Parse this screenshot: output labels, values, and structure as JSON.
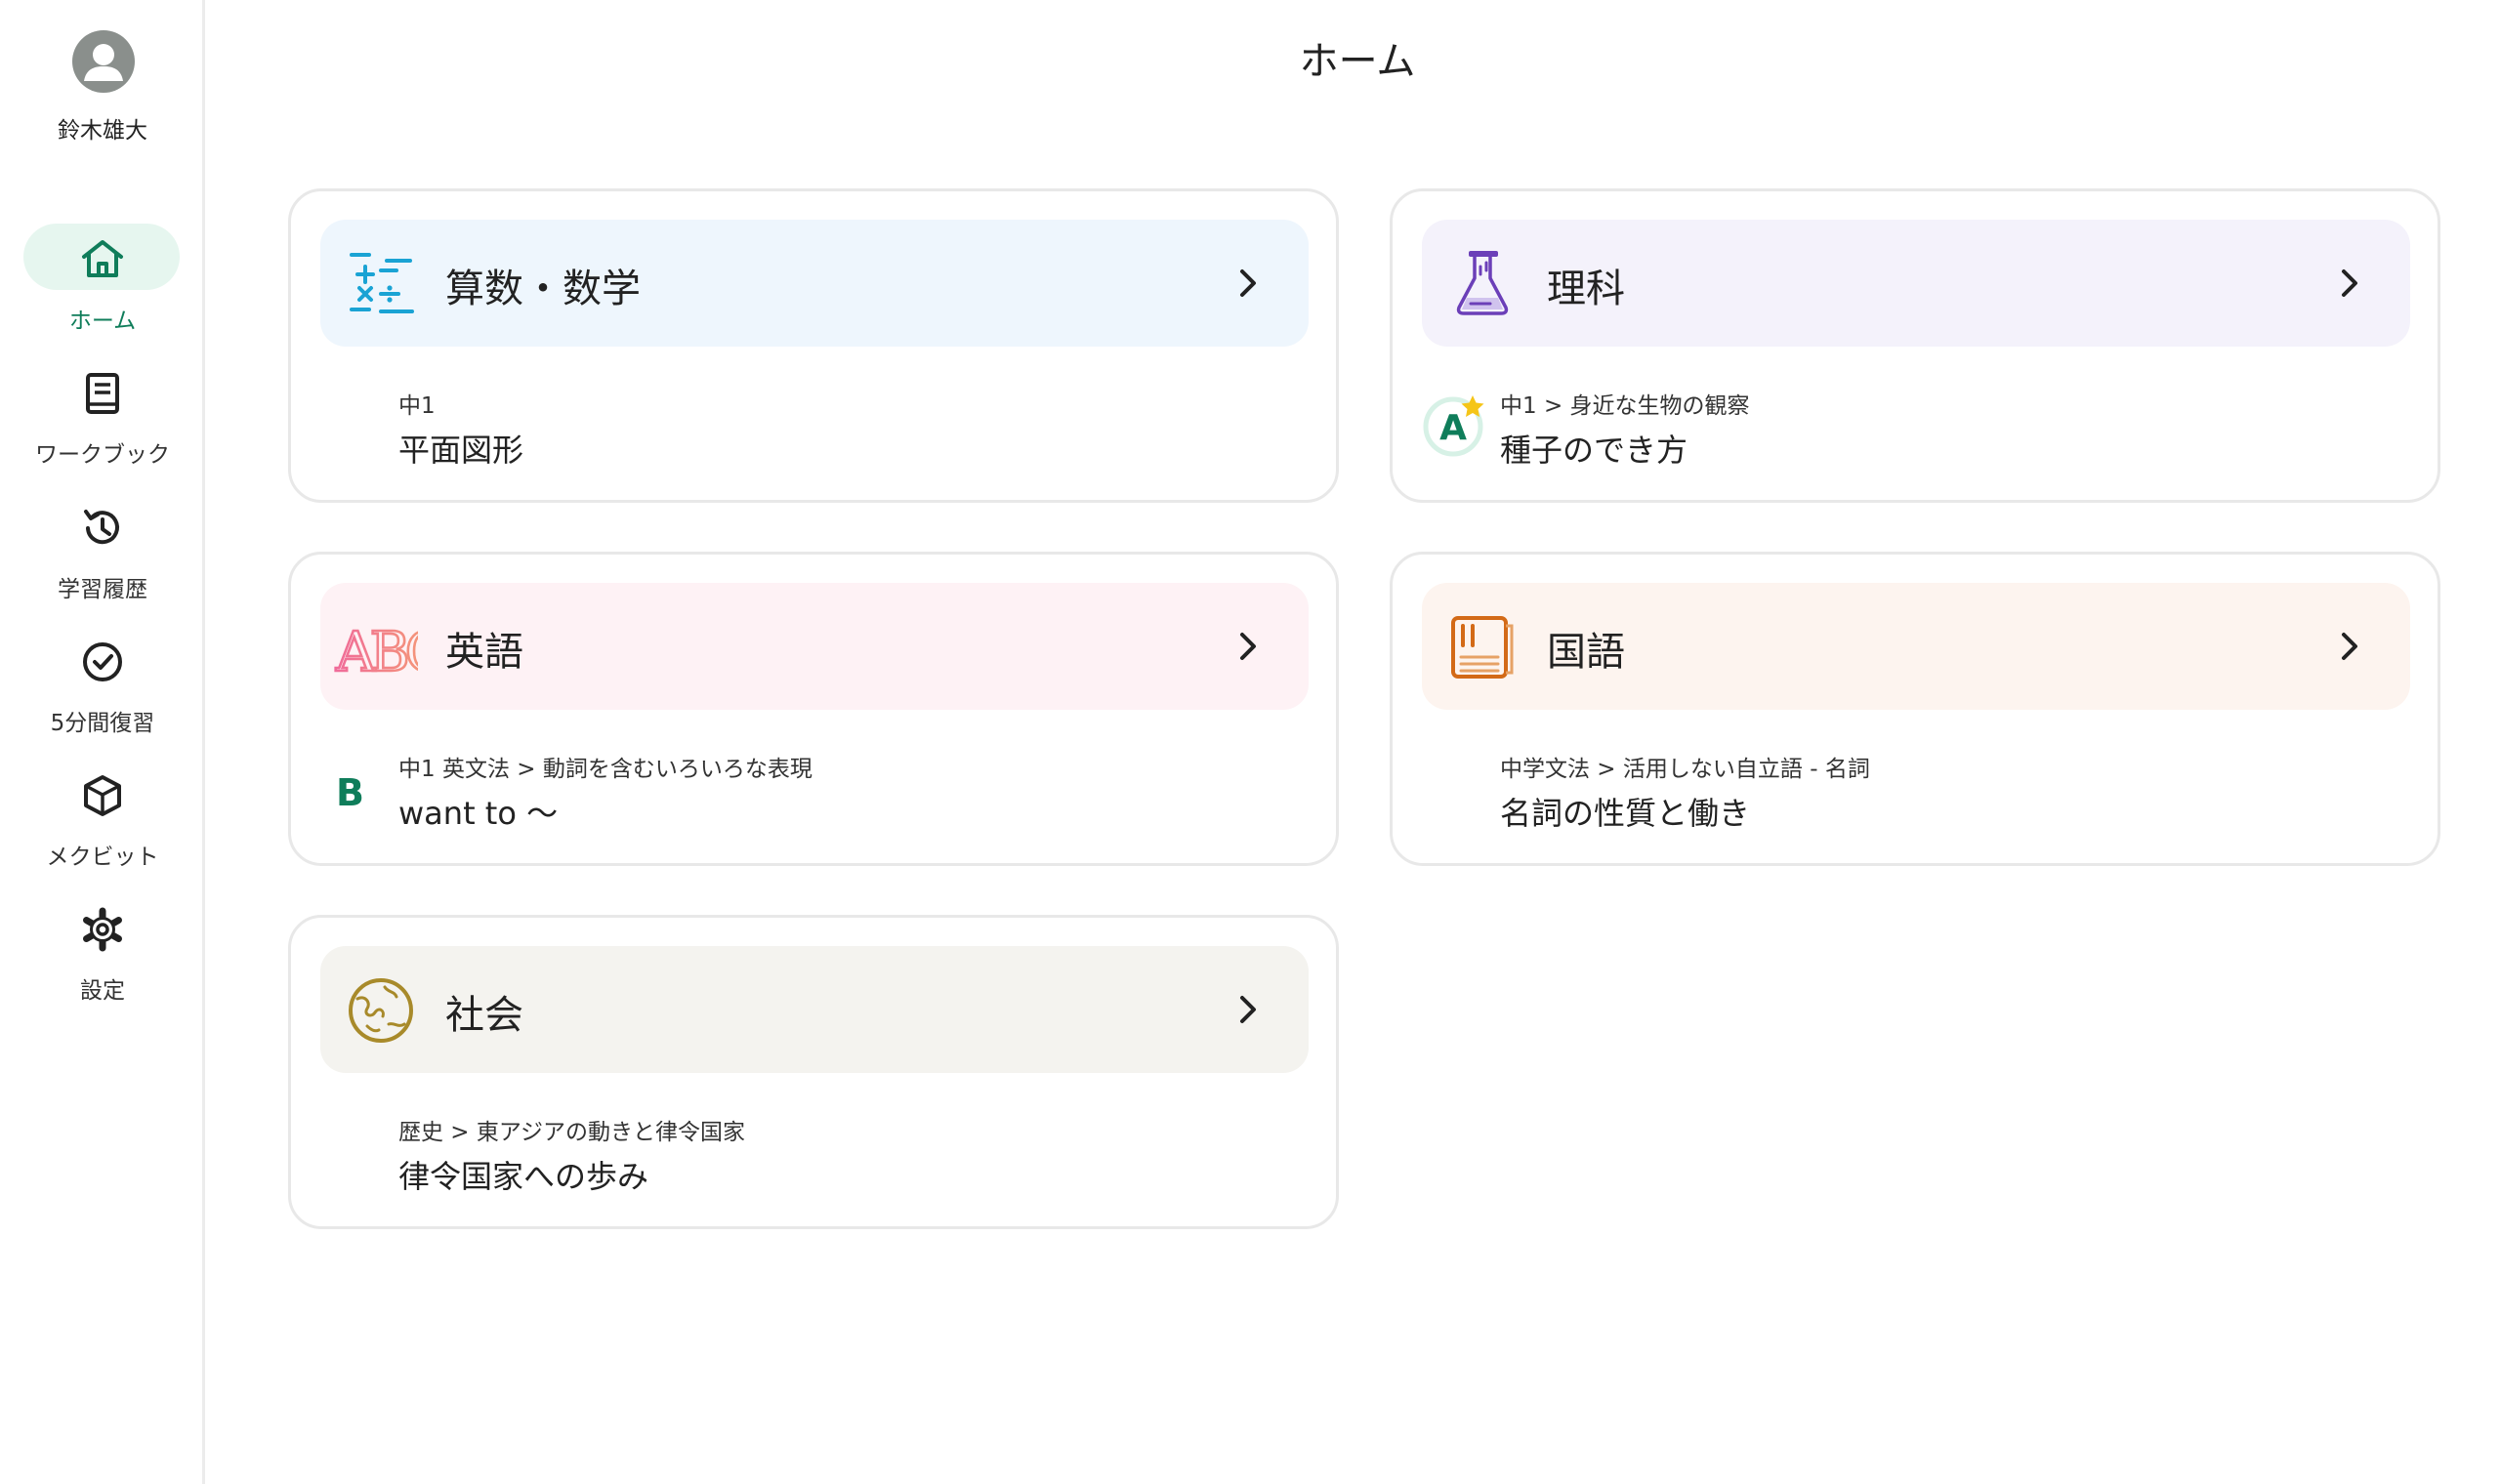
{
  "user": {
    "name": "鈴木雄大"
  },
  "page": {
    "title": "ホーム"
  },
  "nav": {
    "items": [
      {
        "label": "ホーム",
        "icon": "home-icon",
        "active": true
      },
      {
        "label": "ワークブック",
        "icon": "book-icon"
      },
      {
        "label": "学習履歴",
        "icon": "history-icon"
      },
      {
        "label": "5分間復習",
        "icon": "check-circle-icon"
      },
      {
        "label": "メクビット",
        "icon": "cube-icon"
      },
      {
        "label": "設定",
        "icon": "gear-icon"
      }
    ]
  },
  "cards": [
    {
      "subject": "算数・数学",
      "icon": "math-symbols-icon",
      "breadcrumb": "中1",
      "lesson": "平面図形",
      "header_bg": "#eef6fd"
    },
    {
      "subject": "理科",
      "icon": "flask-icon",
      "breadcrumb": "中1 > 身近な生物の観察",
      "lesson": "種子のでき方",
      "badge": "A",
      "header_bg": "#f4f2fb"
    },
    {
      "subject": "英語",
      "icon": "abc-icon",
      "breadcrumb": "中1 英文法 > 動詞を含むいろいろな表現",
      "lesson": "want to 〜",
      "badge": "B",
      "header_bg": "#fef2f5"
    },
    {
      "subject": "国語",
      "icon": "japanese-book-icon",
      "breadcrumb": "中学文法 > 活用しない自立語 - 名詞",
      "lesson": "名詞の性質と働き",
      "header_bg": "#fdf4ef"
    },
    {
      "subject": "社会",
      "icon": "globe-icon",
      "breadcrumb": "歴史 > 東アジアの動きと律令国家",
      "lesson": "律令国家への歩み",
      "header_bg": "#f4f3ef"
    }
  ],
  "colors": {
    "accent": "#0f7d5a",
    "active_bg": "#e6f6ef",
    "gold": "#f5c518"
  }
}
